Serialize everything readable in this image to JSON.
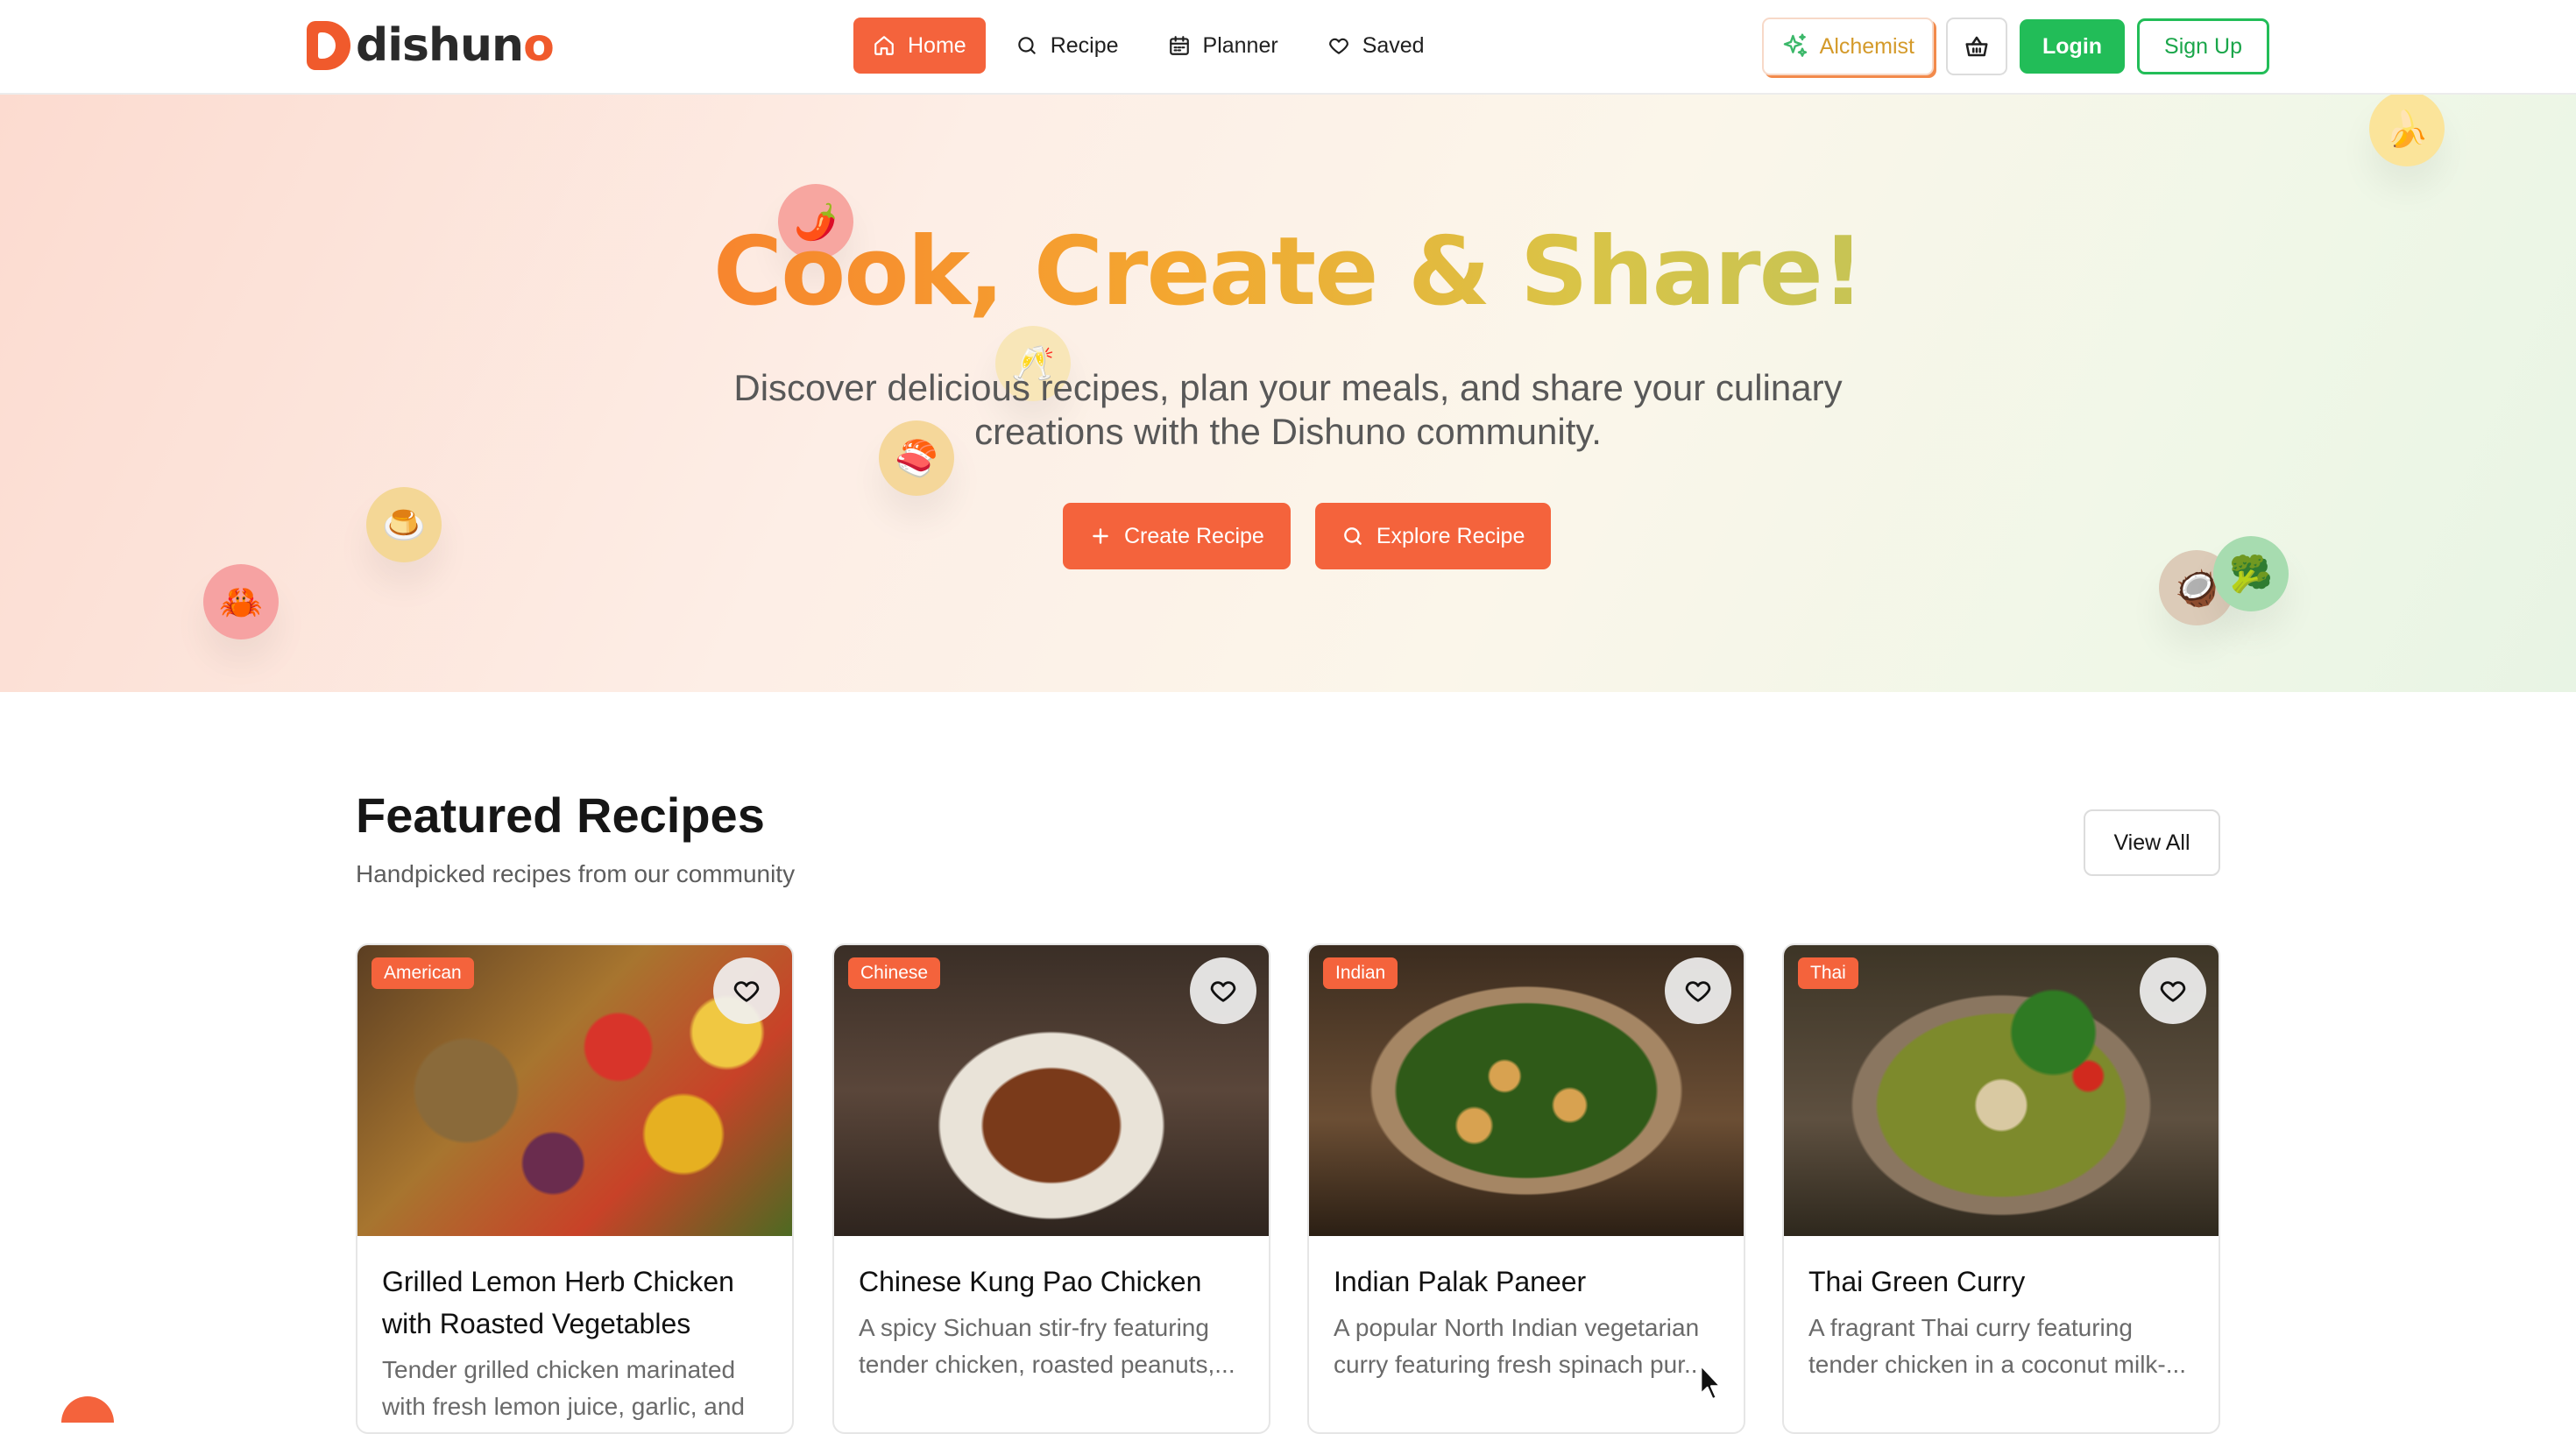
{
  "brand": {
    "name_prefix": "dishun",
    "name_suffix": "o",
    "color": "#f05a2c"
  },
  "nav": {
    "links": [
      {
        "label": "Home",
        "icon": "home-icon",
        "active": true
      },
      {
        "label": "Recipe",
        "icon": "search-icon",
        "active": false
      },
      {
        "label": "Planner",
        "icon": "calendar-icon",
        "active": false
      },
      {
        "label": "Saved",
        "icon": "heart-icon",
        "active": false
      }
    ],
    "alchemist_label": "Alchemist",
    "login_label": "Login",
    "signup_label": "Sign Up"
  },
  "hero": {
    "title": "Cook, Create & Share!",
    "subtitle": "Discover delicious recipes, plan your meals, and share your culinary creations with the Dishuno community.",
    "create_label": "Create Recipe",
    "explore_label": "Explore Recipe",
    "floating_emojis": [
      "🌶️",
      "🥂",
      "🍣",
      "🍮",
      "🦀",
      "🍌",
      "🥥",
      "🥦"
    ]
  },
  "featured": {
    "title": "Featured Recipes",
    "subtitle": "Handpicked recipes from our community",
    "view_all_label": "View All",
    "recipes": [
      {
        "cuisine": "American",
        "title": "Grilled Lemon Herb Chicken with Roasted Vegetables",
        "description": "Tender grilled chicken marinated with fresh lemon juice, garlic, and"
      },
      {
        "cuisine": "Chinese",
        "title": "Chinese Kung Pao Chicken",
        "description": "A spicy Sichuan stir-fry featuring tender chicken, roasted peanuts,..."
      },
      {
        "cuisine": "Indian",
        "title": "Indian Palak Paneer",
        "description": "A popular North Indian vegetarian curry featuring fresh spinach pur..."
      },
      {
        "cuisine": "Thai",
        "title": "Thai Green Curry",
        "description": "A fragrant Thai curry featuring tender chicken in a coconut milk-..."
      }
    ]
  },
  "colors": {
    "primary": "#f4633c",
    "green": "#22bd58",
    "alchemist": "#d49a2a"
  }
}
